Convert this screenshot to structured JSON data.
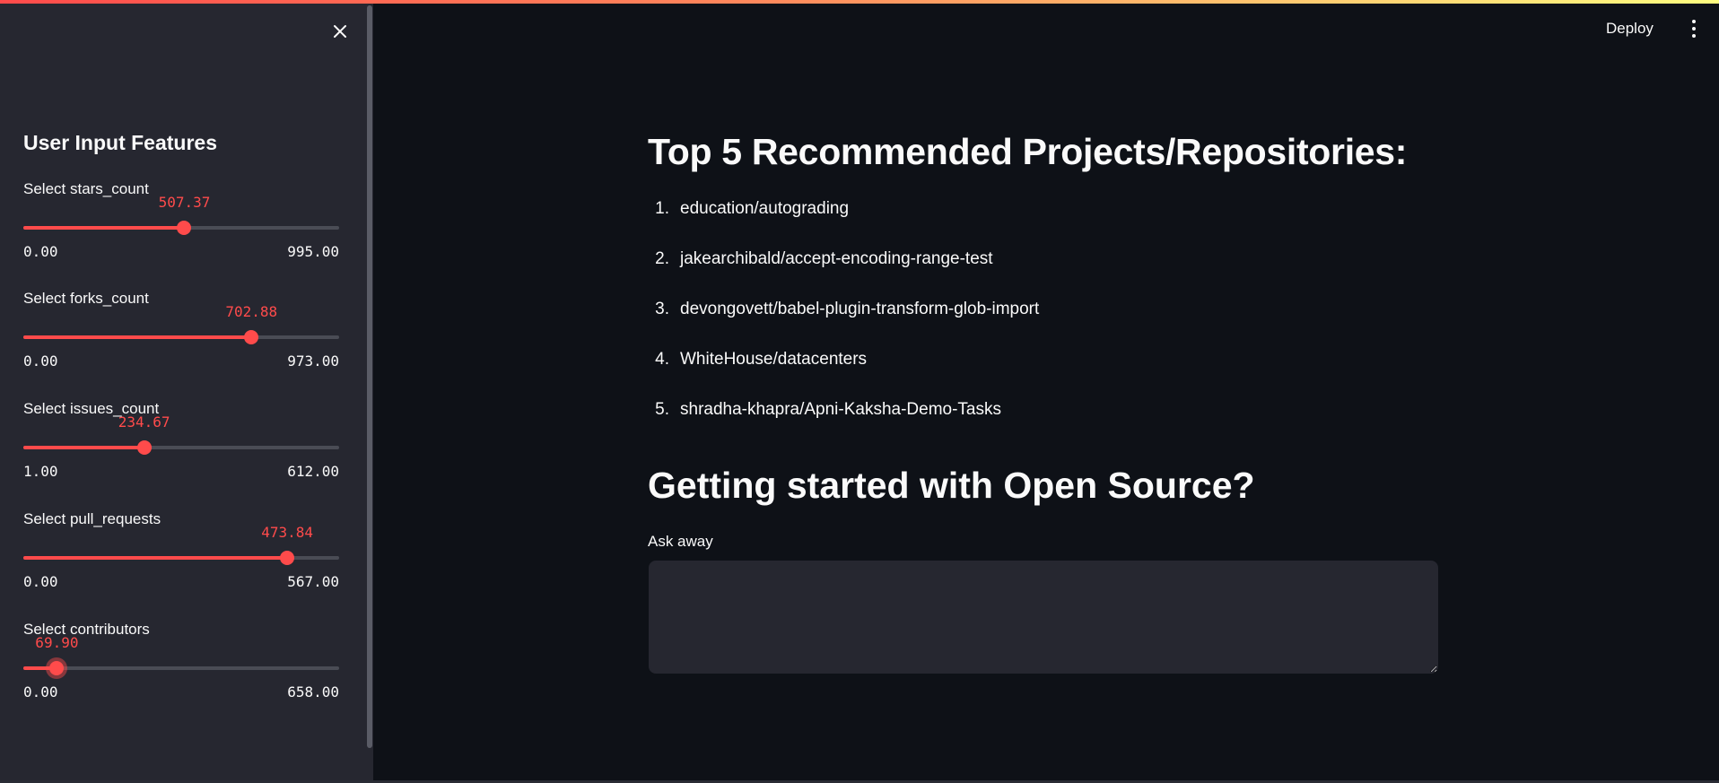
{
  "sidebar": {
    "title": "User Input Features",
    "close_icon": "close-icon",
    "sliders": [
      {
        "label": "Select stars_count",
        "value": "507.37",
        "min": "0.00",
        "max": "995.00",
        "value_num": 507.37,
        "min_num": 0,
        "max_num": 995
      },
      {
        "label": "Select forks_count",
        "value": "702.88",
        "min": "0.00",
        "max": "973.00",
        "value_num": 702.88,
        "min_num": 0,
        "max_num": 973
      },
      {
        "label": "Select issues_count",
        "value": "234.67",
        "min": "1.00",
        "max": "612.00",
        "value_num": 234.67,
        "min_num": 1,
        "max_num": 612
      },
      {
        "label": "Select pull_requests",
        "value": "473.84",
        "min": "0.00",
        "max": "567.00",
        "value_num": 473.84,
        "min_num": 0,
        "max_num": 567
      },
      {
        "label": "Select contributors",
        "value": "69.90",
        "min": "0.00",
        "max": "658.00",
        "value_num": 69.9,
        "min_num": 0,
        "max_num": 658
      }
    ]
  },
  "header": {
    "deploy_label": "Deploy",
    "menu_icon": "kebab-menu-icon"
  },
  "main": {
    "title": "Top 5 Recommended Projects/Repositories:",
    "recommendations": [
      {
        "num": "1.",
        "name": "education/autograding"
      },
      {
        "num": "2.",
        "name": "jakearchibald/accept-encoding-range-test"
      },
      {
        "num": "3.",
        "name": "devongovett/babel-plugin-transform-glob-import"
      },
      {
        "num": "4.",
        "name": "WhiteHouse/datacenters"
      },
      {
        "num": "5.",
        "name": "shradha-khapra/Apni-Kaksha-Demo-Tasks"
      }
    ],
    "section_title": "Getting started with Open Source?",
    "ask_label": "Ask away",
    "ask_value": ""
  },
  "colors": {
    "accent": "#ff4b4b",
    "background": "#0e1117",
    "sidebar": "#262730"
  }
}
